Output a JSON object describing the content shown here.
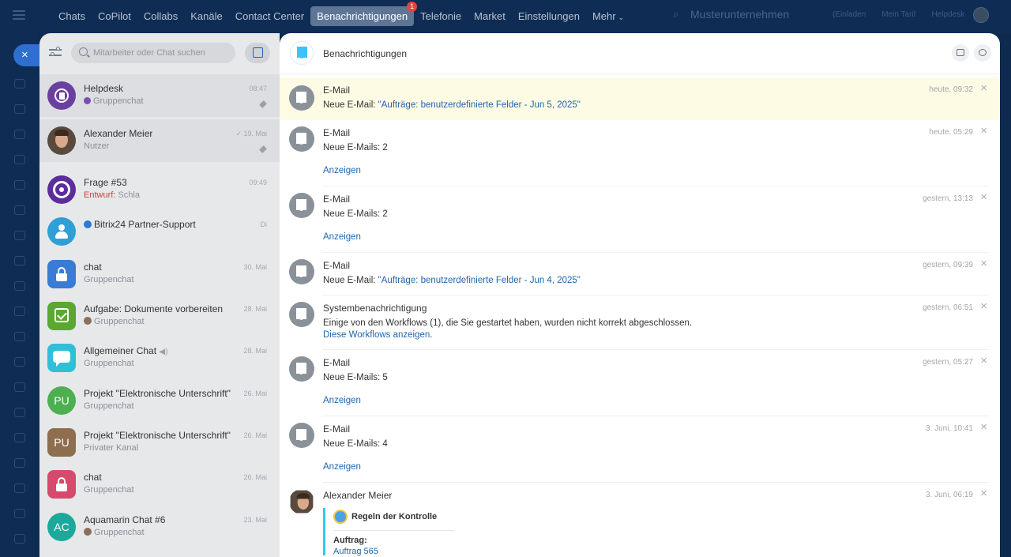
{
  "topnav": {
    "items": [
      "Chats",
      "CoPilot",
      "Collabs",
      "Kanäle",
      "Contact Center",
      "Benachrichtigungen",
      "Telefonie",
      "Market",
      "Einstellungen",
      "Mehr"
    ],
    "active_index": 5,
    "notification_badge": "1",
    "company": "Musterunternehmen",
    "right_links": [
      "(Einladen",
      "Mein Tarif",
      "Helpdesk"
    ]
  },
  "chatpanel": {
    "search_placeholder": "Mitarbeiter oder Chat suchen",
    "chats": [
      {
        "title": "Helpdesk",
        "subtitle": "Gruppenchat",
        "date": "08:47",
        "pinned": true,
        "avatar_color": "#6b3fa0"
      },
      {
        "title": "Alexander Meier",
        "subtitle": "Nutzer",
        "date": "19. Mai",
        "pinned": true,
        "avatar_color": "#5a4a3e"
      },
      {
        "title": "Frage #53",
        "draft_label": "Entwurf:",
        "subtitle": "Schla",
        "date": "09:49",
        "avatar_color": "#5b2d9c"
      },
      {
        "title": "Bitrix24 Partner-Support",
        "subtitle": "",
        "date": "Di",
        "avatar_color": "#2f9fd6"
      },
      {
        "title": "chat",
        "subtitle": "Gruppenchat",
        "date": "30. Mai",
        "avatar_color": "#3a7bd5"
      },
      {
        "title": "Aufgabe: Dokumente vorbereiten",
        "subtitle": "Gruppenchat",
        "date": "28. Mai",
        "avatar_color": "#5aa832"
      },
      {
        "title": "Allgemeiner Chat",
        "subtitle": "Gruppenchat",
        "date": "28. Mai",
        "avatar_color": "#2fc0d8"
      },
      {
        "title": "Projekt \"Elektronische Unterschrift\"",
        "subtitle": "Gruppenchat",
        "date": "26. Mai",
        "avatar_text": "PU",
        "avatar_color": "#4caf50"
      },
      {
        "title": "Projekt \"Elektronische Unterschrift\"",
        "subtitle": "Privater Kanal",
        "date": "26. Mai",
        "avatar_text": "PU",
        "avatar_color": "#8d6e4f"
      },
      {
        "title": "chat",
        "subtitle": "Gruppenchat",
        "date": "26. Mai",
        "avatar_color": "#d64a6e"
      },
      {
        "title": "Aquamarin Chat #6",
        "subtitle": "Gruppenchat",
        "date": "23. Mai",
        "avatar_text": "AC",
        "avatar_color": "#1aa99a"
      }
    ]
  },
  "notifications": {
    "title": "Benachrichtigungen",
    "items": [
      {
        "sender": "E-Mail",
        "prefix": "Neue E-Mail: ",
        "quoted": "\"Aufträge: benutzerdefinierte Felder - Jun 5, 2025\"",
        "time": "heute, 09:32",
        "highlighted": true
      },
      {
        "sender": "E-Mail",
        "prefix": "Neue E-Mails: 2",
        "quoted": "",
        "time": "heute, 05:29",
        "link": "Anzeigen"
      },
      {
        "sender": "E-Mail",
        "prefix": "Neue E-Mails: 2",
        "quoted": "",
        "time": "gestern, 13:13",
        "link": "Anzeigen"
      },
      {
        "sender": "E-Mail",
        "prefix": "Neue E-Mail: ",
        "quoted": "\"Aufträge: benutzerdefinierte Felder - Jun 4, 2025\"",
        "time": "gestern, 09:39"
      },
      {
        "sender": "Systembenachrichtigung",
        "prefix": "Einige von den Workflows (1), die Sie gestartet haben, wurden nicht korrekt abgeschlossen.",
        "quoted": "",
        "time": "gestern, 06:51",
        "link": "Diese Workflows anzeigen",
        "link_suffix": "."
      },
      {
        "sender": "E-Mail",
        "prefix": "Neue E-Mails: 5",
        "quoted": "",
        "time": "gestern, 05:27",
        "link": "Anzeigen"
      },
      {
        "sender": "E-Mail",
        "prefix": "Neue E-Mails: 4",
        "quoted": "",
        "time": "3. Juni, 10:41",
        "link": "Anzeigen"
      },
      {
        "sender": "Alexander Meier",
        "time": "3. Juni, 06:19",
        "card_title": "Regeln der Kontrolle",
        "card_label": "Auftrag:",
        "card_link": "Auftrag 565"
      }
    ]
  },
  "icons": {
    "close": "×",
    "bell": "bell-icon",
    "mehr_chevron": "⌄"
  }
}
